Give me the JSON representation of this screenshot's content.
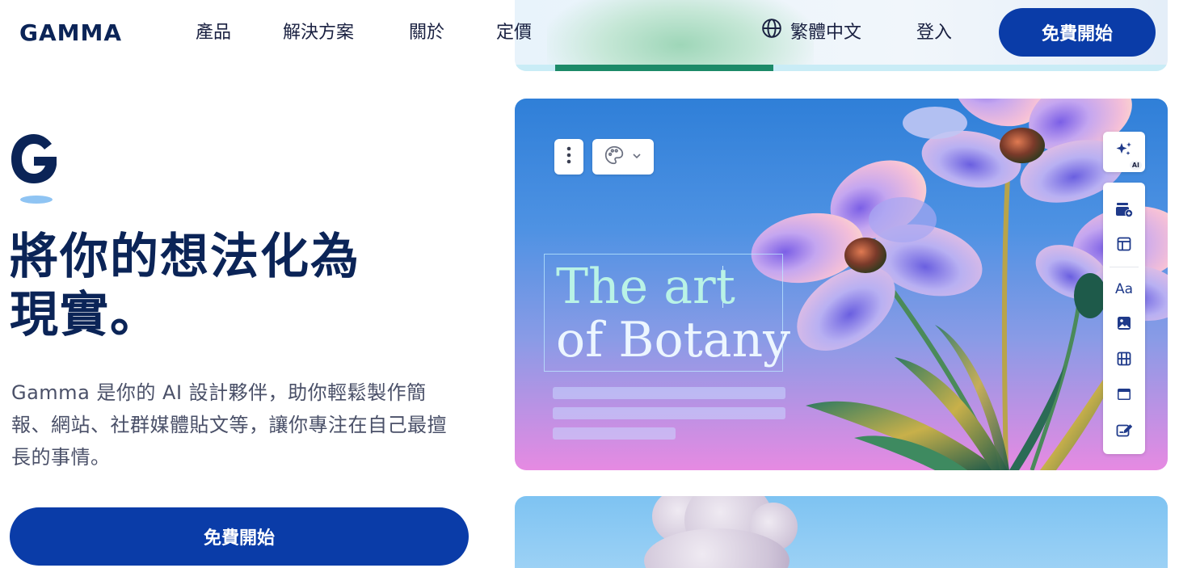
{
  "header": {
    "logo": "GAMMA",
    "nav": [
      "產品",
      "解決方案",
      "關於",
      "定價"
    ],
    "language": "繁體中文",
    "login": "登入",
    "cta": "免費開始"
  },
  "hero": {
    "title_line1": "將你的想法化為",
    "title_line2": "現實。",
    "description": "Gamma 是你的 AI 設計夥伴，助你輕鬆製作簡報、網站、社群媒體貼文等，讓你專注在自己最擅長的事情。",
    "cta": "免費開始"
  },
  "card": {
    "title_line1": "The art",
    "title_line2": "of Botany",
    "ai_badge": "AI",
    "text_tool": "Aa"
  },
  "colors": {
    "brand_navy": "#0b2457",
    "cta_blue": "#0a3ca8",
    "icon_blue": "#1f3a8a"
  }
}
